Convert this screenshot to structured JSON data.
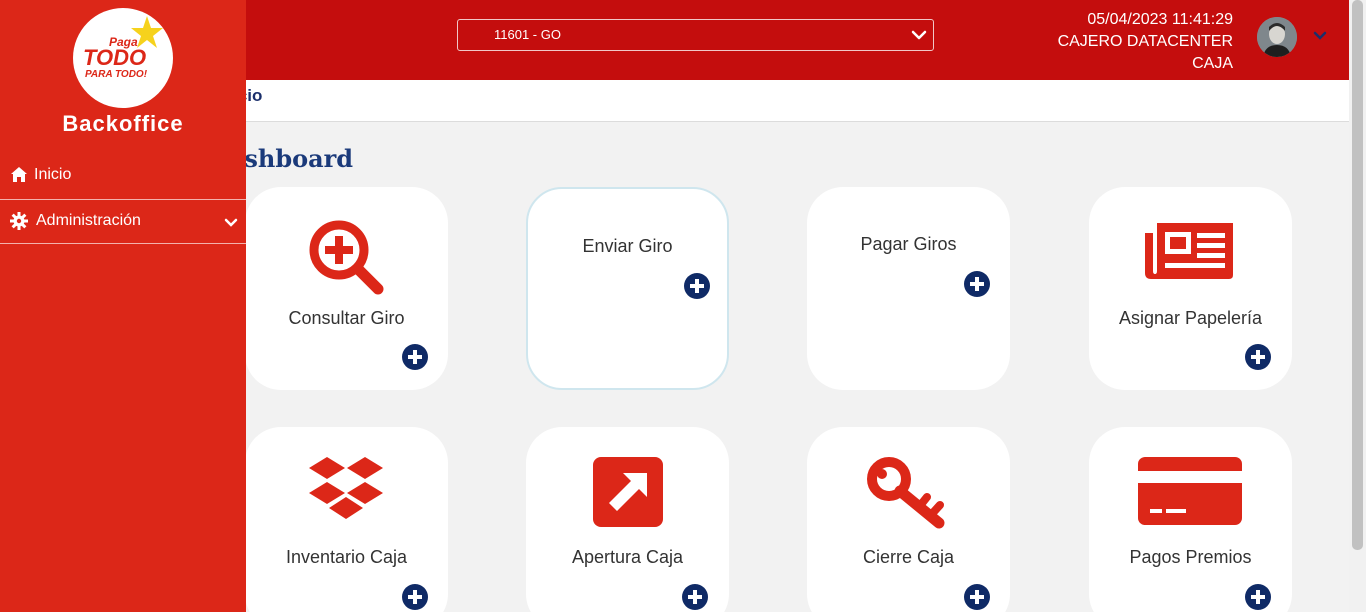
{
  "header": {
    "branch_select": "11601 - GO",
    "datetime": "05/04/2023 11:41:29",
    "user_name": "CAJERO DATACENTER",
    "role": "CAJA"
  },
  "sidebar": {
    "logo_text": [
      "Paga",
      "TODO",
      "PARA TODO!"
    ],
    "app_title": "Backoffice",
    "items": [
      {
        "label": "Inicio",
        "icon": "home-icon"
      },
      {
        "label": "Administración",
        "icon": "gear-icon"
      }
    ]
  },
  "breadcrumb": "Inicio",
  "page_title": "Dashboard",
  "cards": [
    {
      "label": "Consultar Giro",
      "icon": "search-plus-icon"
    },
    {
      "label": "Enviar Giro",
      "icon": ""
    },
    {
      "label": "Pagar Giros",
      "icon": ""
    },
    {
      "label": "Asignar Papelería",
      "icon": "newspaper-icon"
    },
    {
      "label": "Inventario Caja",
      "icon": "dropbox-icon"
    },
    {
      "label": "Apertura Caja",
      "icon": "external-link-icon"
    },
    {
      "label": "Cierre Caja",
      "icon": "key-icon"
    },
    {
      "label": "Pagos Premios",
      "icon": "credit-card-icon"
    }
  ],
  "colors": {
    "topbar": "#c40d0d",
    "sidebar": "#dc2718",
    "icon_red": "#dc2718",
    "accent_navy": "#0f2a66",
    "title_navy": "#1b3a7a"
  }
}
